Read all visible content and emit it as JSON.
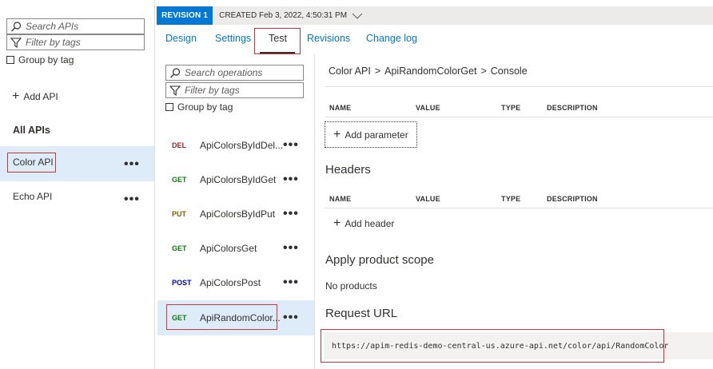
{
  "left_panel": {
    "search_apis_placeholder": "Search APIs",
    "filter_tags_placeholder": "Filter by tags",
    "group_by_tag": "Group by tag",
    "add_api": "Add API",
    "all_apis": "All APIs",
    "apis": [
      {
        "label": "Color API",
        "selected": true
      },
      {
        "label": "Echo API",
        "selected": false
      }
    ]
  },
  "revision_bar": {
    "badge": "REVISION 1",
    "created": "CREATED Feb 3, 2022, 4:50:31 PM"
  },
  "tabs": [
    {
      "label": "Design",
      "active": false
    },
    {
      "label": "Settings",
      "active": false
    },
    {
      "label": "Test",
      "active": true
    },
    {
      "label": "Revisions",
      "active": false
    },
    {
      "label": "Change log",
      "active": false
    }
  ],
  "operations_panel": {
    "search_placeholder": "Search operations",
    "filter_placeholder": "Filter by tags",
    "group_by_tag": "Group by tag",
    "operations": [
      {
        "verb": "DEL",
        "name": "ApiColorsByIdDel...",
        "selected": false
      },
      {
        "verb": "GET",
        "name": "ApiColorsByIdGet",
        "selected": false
      },
      {
        "verb": "PUT",
        "name": "ApiColorsByIdPut",
        "selected": false
      },
      {
        "verb": "GET",
        "name": "ApiColorsGet",
        "selected": false
      },
      {
        "verb": "POST",
        "name": "ApiColorsPost",
        "selected": false
      },
      {
        "verb": "GET",
        "name": "ApiRandomColor...",
        "selected": true
      }
    ]
  },
  "console": {
    "breadcrumb": [
      "Color API",
      "ApiRandomColorGet",
      "Console"
    ],
    "columns": {
      "name": "NAME",
      "value": "VALUE",
      "type": "TYPE",
      "description": "DESCRIPTION"
    },
    "add_parameter": "Add parameter",
    "headers_title": "Headers",
    "add_header": "Add header",
    "product_scope_title": "Apply product scope",
    "no_products": "No products",
    "request_url_title": "Request URL",
    "request_url": "https://apim-redis-demo-central-us.azure-api.net/color/api/RandomColor"
  },
  "icons": [
    "search-icon",
    "filter-icon",
    "plus-icon",
    "chevron-down-icon",
    "more-icon"
  ],
  "colors": {
    "accent": "#0078d4",
    "selected_bg": "#deecf9",
    "highlight_border": "#d13438"
  }
}
